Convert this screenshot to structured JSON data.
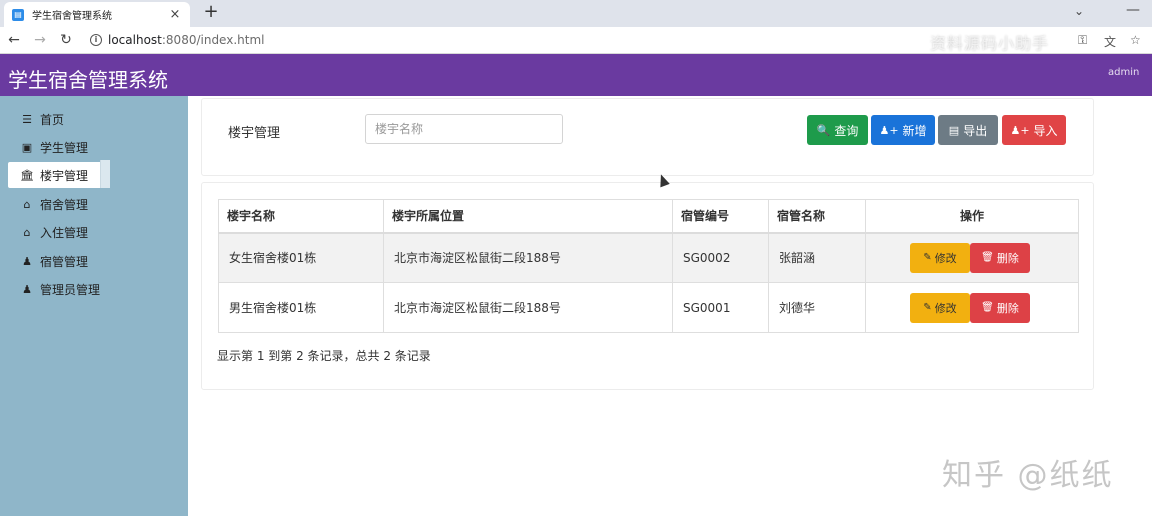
{
  "browser": {
    "tab_title": "学生宿舍管理系统",
    "tab_close": "×",
    "new_tab": "+",
    "url_host": "localhost",
    "url_path": ":8080/index.html",
    "watermark_top": "资料源码小助手"
  },
  "header": {
    "app_title": "学生宿舍管理系统",
    "user": "admin",
    "brand_color": "#6a3aa0"
  },
  "sidebar": {
    "items": [
      {
        "icon": "☰",
        "label": "首页"
      },
      {
        "icon": "▣",
        "label": "学生管理"
      },
      {
        "icon": "🏛",
        "label": "楼宇管理",
        "active": true
      },
      {
        "icon": "⌂",
        "label": "宿舍管理"
      },
      {
        "icon": "⌂",
        "label": "入住管理"
      },
      {
        "icon": "♟",
        "label": "宿管管理"
      },
      {
        "icon": "♟",
        "label": "管理员管理"
      }
    ]
  },
  "search": {
    "label": "楼宇管理",
    "placeholder": "楼宇名称",
    "buttons": {
      "query": "查询",
      "add": "新增",
      "export": "导出",
      "import": "导入"
    }
  },
  "table": {
    "headers": [
      "楼宇名称",
      "楼宇所属位置",
      "宿管编号",
      "宿管名称",
      "操作"
    ],
    "rows": [
      [
        "女生宿舍楼01栋",
        "北京市海淀区松鼠街二段188号",
        "SG0002",
        "张韶涵"
      ],
      [
        "男生宿舍楼01栋",
        "北京市海淀区松鼠街二段188号",
        "SG0001",
        "刘德华"
      ]
    ],
    "edit_label": "修改",
    "delete_label": "删除"
  },
  "pagination": {
    "info": "显示第 1 到第 2 条记录，总共 2 条记录"
  },
  "watermark": "知乎 @纸纸"
}
